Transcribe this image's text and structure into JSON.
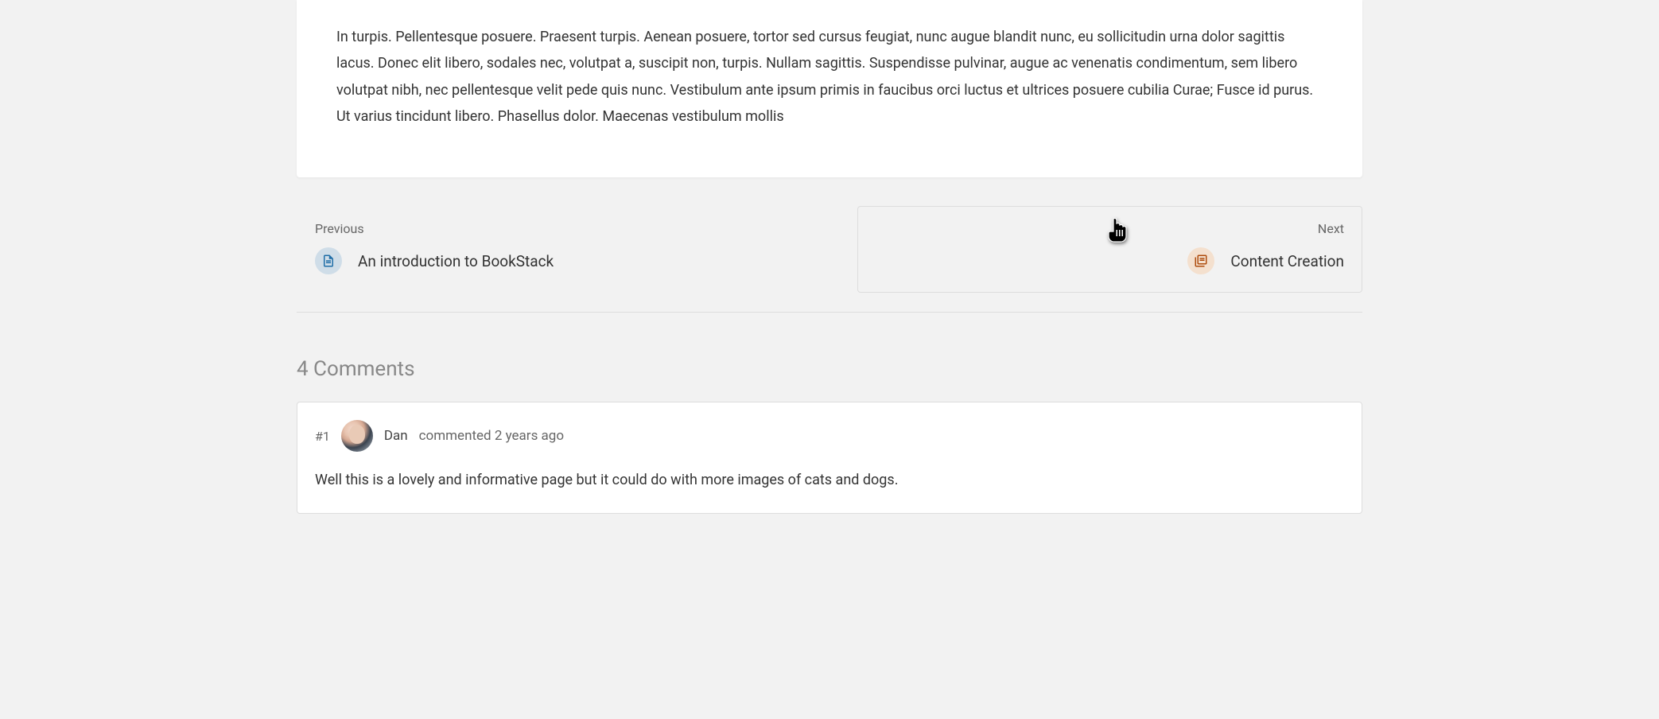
{
  "content": {
    "paragraph": "In turpis. Pellentesque posuere. Praesent turpis. Aenean posuere, tortor sed cursus feugiat, nunc augue blandit nunc, eu sollicitudin urna dolor sagittis lacus. Donec elit libero, sodales nec, volutpat a, suscipit non, turpis. Nullam sagittis. Suspendisse pulvinar, augue ac venenatis condimentum, sem libero volutpat nibh, nec pellentesque velit pede quis nunc. Vestibulum ante ipsum primis in faucibus orci luctus et ultrices posuere cubilia Curae; Fusce id purus. Ut varius tincidunt libero. Phasellus dolor. Maecenas vestibulum mollis"
  },
  "nav": {
    "previous": {
      "label": "Previous",
      "title": "An introduction to BookStack"
    },
    "next": {
      "label": "Next",
      "title": "Content Creation"
    }
  },
  "comments": {
    "heading": "4 Comments",
    "items": [
      {
        "number": "#1",
        "author": "Dan",
        "meta": "commented 2 years ago",
        "body": "Well this is a lovely and informative page but it could do with more images of cats and dogs."
      }
    ]
  },
  "colors": {
    "page_icon": "#206ea7",
    "chapter_icon": "#af4d0e"
  }
}
